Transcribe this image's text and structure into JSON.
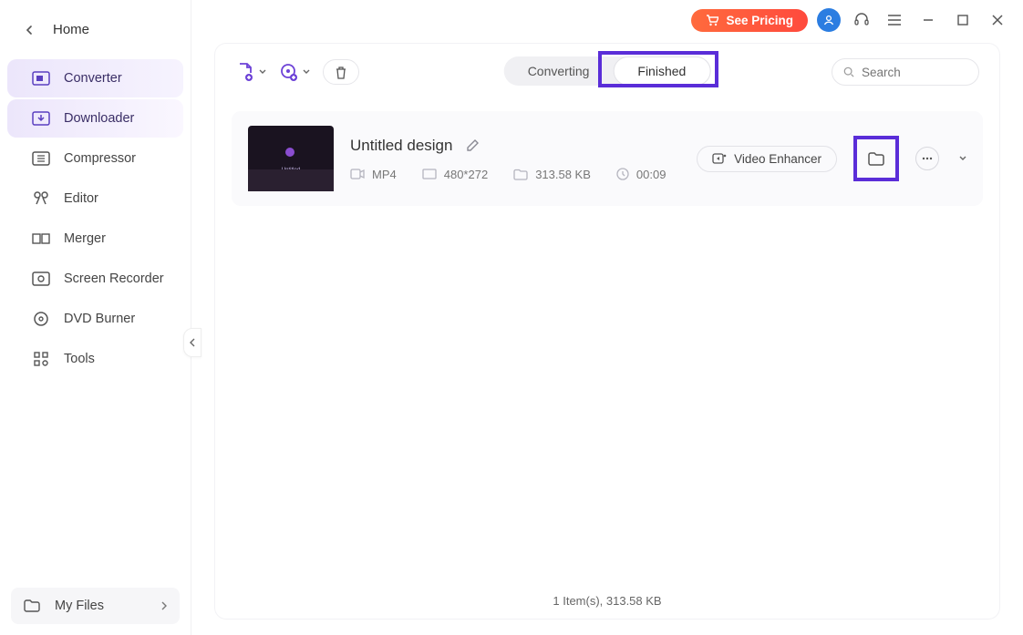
{
  "nav": {
    "home": "Home",
    "items": [
      {
        "label": "Converter"
      },
      {
        "label": "Downloader"
      },
      {
        "label": "Compressor"
      },
      {
        "label": "Editor"
      },
      {
        "label": "Merger"
      },
      {
        "label": "Screen Recorder"
      },
      {
        "label": "DVD Burner"
      },
      {
        "label": "Tools"
      }
    ],
    "myfiles": "My Files"
  },
  "titlebar": {
    "pricing": "See Pricing"
  },
  "tabs": {
    "converting": "Converting",
    "finished": "Finished"
  },
  "search": {
    "placeholder": "Search"
  },
  "file": {
    "title": "Untitled design",
    "format": "MP4",
    "resolution": "480*272",
    "size": "313.58 KB",
    "duration": "00:09",
    "enhancer": "Video Enhancer"
  },
  "footer": {
    "summary": "1 Item(s), 313.58 KB"
  }
}
